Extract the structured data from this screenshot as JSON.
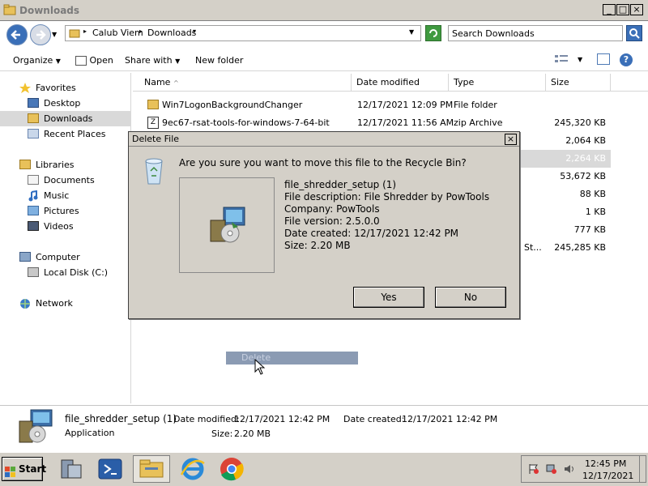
{
  "window": {
    "title": "Downloads"
  },
  "address": {
    "crumbs": [
      "Calub Viem",
      "Downloads"
    ],
    "search_placeholder": "Search Downloads"
  },
  "toolbar": {
    "organize": "Organize",
    "open": "Open",
    "share_with": "Share with",
    "new_folder": "New folder"
  },
  "nav": {
    "favorites": "Favorites",
    "desktop": "Desktop",
    "downloads": "Downloads",
    "recent_places": "Recent Places",
    "libraries": "Libraries",
    "documents": "Documents",
    "music": "Music",
    "pictures": "Pictures",
    "videos": "Videos",
    "computer": "Computer",
    "local_disk": "Local Disk (C:)",
    "network": "Network"
  },
  "columns": {
    "name": "Name",
    "date_modified": "Date modified",
    "type": "Type",
    "size": "Size"
  },
  "files": [
    {
      "name": "Win7LogonBackgroundChanger",
      "date": "12/17/2021 12:09 PM",
      "type": "File folder",
      "size": ""
    },
    {
      "name": "9ec67-rsat-tools-for-windows-7-64-bit",
      "date": "12/17/2021 11:56 AM",
      "type": "zip Archive",
      "size": "245,320 KB"
    },
    {
      "name": "",
      "date": "",
      "type": "",
      "size": "2,064 KB"
    },
    {
      "name": "",
      "date": "",
      "type": "",
      "size": "2,264 KB"
    },
    {
      "name": "",
      "date": "",
      "type": "",
      "size": "53,672 KB"
    },
    {
      "name": "",
      "date": "",
      "type": "",
      "size": "88 KB"
    },
    {
      "name": "",
      "date": "",
      "type": "",
      "size": "1 KB"
    },
    {
      "name": "",
      "date": "",
      "type": "",
      "size": "777 KB"
    },
    {
      "name": "",
      "date": "",
      "type": "St...",
      "size": "245,285 KB"
    }
  ],
  "dialog": {
    "title": "Delete File",
    "question": "Are you sure you want to move this file to the Recycle Bin?",
    "file_name": "file_shredder_setup (1)",
    "description": "File description: File Shredder by PowTools",
    "company": "Company: PowTools",
    "version": "File version: 2.5.0.0",
    "created": "Date created: 12/17/2021 12:42 PM",
    "size": "Size: 2.20 MB",
    "yes": "Yes",
    "no": "No"
  },
  "drag": {
    "label": "Delete"
  },
  "details": {
    "name": "file_shredder_setup (1)",
    "type": "Application",
    "modified_label": "Date modified:",
    "modified_value": "12/17/2021 12:42 PM",
    "created_label": "Date created:",
    "created_value": "12/17/2021 12:42 PM",
    "size_label": "Size:",
    "size_value": "2.20 MB"
  },
  "taskbar": {
    "start": "Start",
    "time": "12:45 PM",
    "date": "12/17/2021"
  }
}
